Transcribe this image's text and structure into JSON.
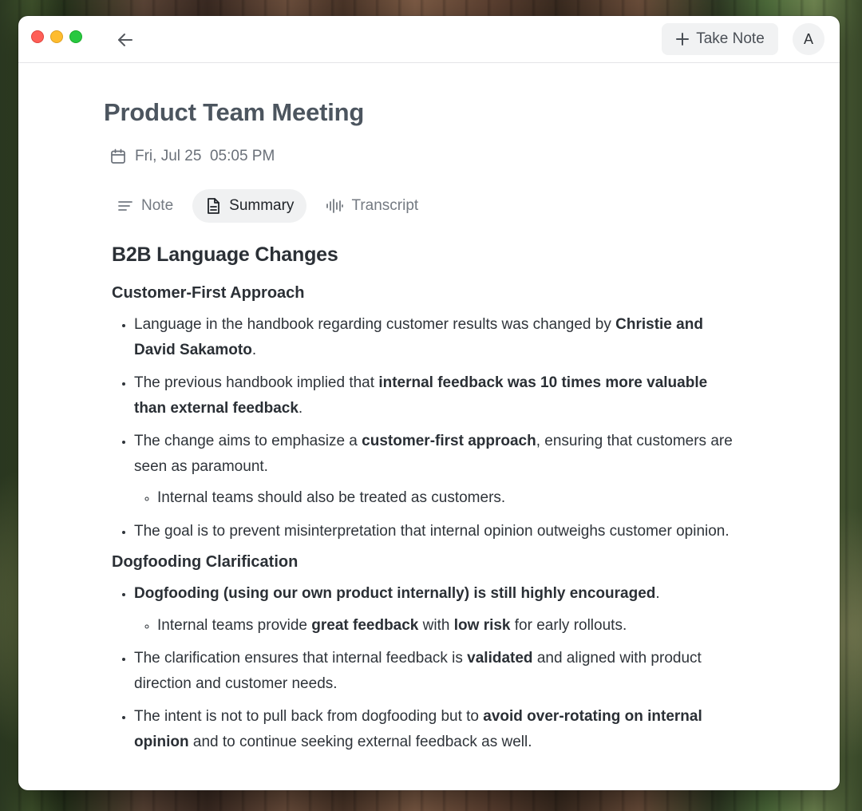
{
  "colors": {
    "accent_button_bg": "#f1f2f3",
    "title_text": "#4c555f",
    "body_text": "#2f343a",
    "traffic_red": "#fe5f57",
    "traffic_yellow": "#febc2e",
    "traffic_green": "#28c840"
  },
  "toolbar": {
    "back_icon": "arrow-left-icon",
    "take_note_label": "Take Note",
    "take_note_icon": "plus-icon",
    "avatar_initial": "A"
  },
  "meeting": {
    "title": "Product Team Meeting",
    "date": "Fri, Jul 25  05:05 PM",
    "date_icon": "calendar-icon"
  },
  "tabs": [
    {
      "label": "Note",
      "icon": "lines-icon",
      "active": false
    },
    {
      "label": "Summary",
      "icon": "document-icon",
      "active": true
    },
    {
      "label": "Transcript",
      "icon": "waveform-icon",
      "active": false
    }
  ],
  "summary": {
    "heading": "B2B Language Changes",
    "sections": [
      {
        "title": "Customer-First Approach",
        "bullets": [
          {
            "parts": [
              {
                "t": "Language in the handbook regarding customer results was changed by ",
                "b": false
              },
              {
                "t": "Christie and David Sakamoto",
                "b": true
              },
              {
                "t": ".",
                "b": false
              }
            ]
          },
          {
            "parts": [
              {
                "t": "The previous handbook implied that ",
                "b": false
              },
              {
                "t": "internal feedback was 10 times more valuable than external feedback",
                "b": true
              },
              {
                "t": ".",
                "b": false
              }
            ]
          },
          {
            "parts": [
              {
                "t": "The change aims to emphasize a ",
                "b": false
              },
              {
                "t": "customer-first approach",
                "b": true
              },
              {
                "t": ", ensuring that customers are seen as paramount.",
                "b": false
              }
            ],
            "sub": [
              {
                "parts": [
                  {
                    "t": "Internal teams should also be treated as customers.",
                    "b": false
                  }
                ]
              }
            ]
          },
          {
            "parts": [
              {
                "t": "The goal is to prevent misinterpretation that internal opinion outweighs customer opinion.",
                "b": false
              }
            ]
          }
        ]
      },
      {
        "title": "Dogfooding Clarification",
        "bullets": [
          {
            "parts": [
              {
                "t": "Dogfooding (using our own product internally) is still highly encouraged",
                "b": true
              },
              {
                "t": ".",
                "b": false
              }
            ],
            "sub": [
              {
                "parts": [
                  {
                    "t": "Internal teams provide ",
                    "b": false
                  },
                  {
                    "t": "great feedback",
                    "b": true
                  },
                  {
                    "t": " with ",
                    "b": false
                  },
                  {
                    "t": "low risk",
                    "b": true
                  },
                  {
                    "t": " for early rollouts.",
                    "b": false
                  }
                ]
              }
            ]
          },
          {
            "parts": [
              {
                "t": "The clarification ensures that internal feedback is ",
                "b": false
              },
              {
                "t": "validated",
                "b": true
              },
              {
                "t": " and aligned with product direction and customer needs.",
                "b": false
              }
            ]
          },
          {
            "parts": [
              {
                "t": "The intent is not to pull back from dogfooding but to ",
                "b": false
              },
              {
                "t": "avoid over-rotating on internal opinion",
                "b": true
              },
              {
                "t": " and to continue seeking external feedback as well.",
                "b": false
              }
            ]
          }
        ]
      }
    ]
  }
}
